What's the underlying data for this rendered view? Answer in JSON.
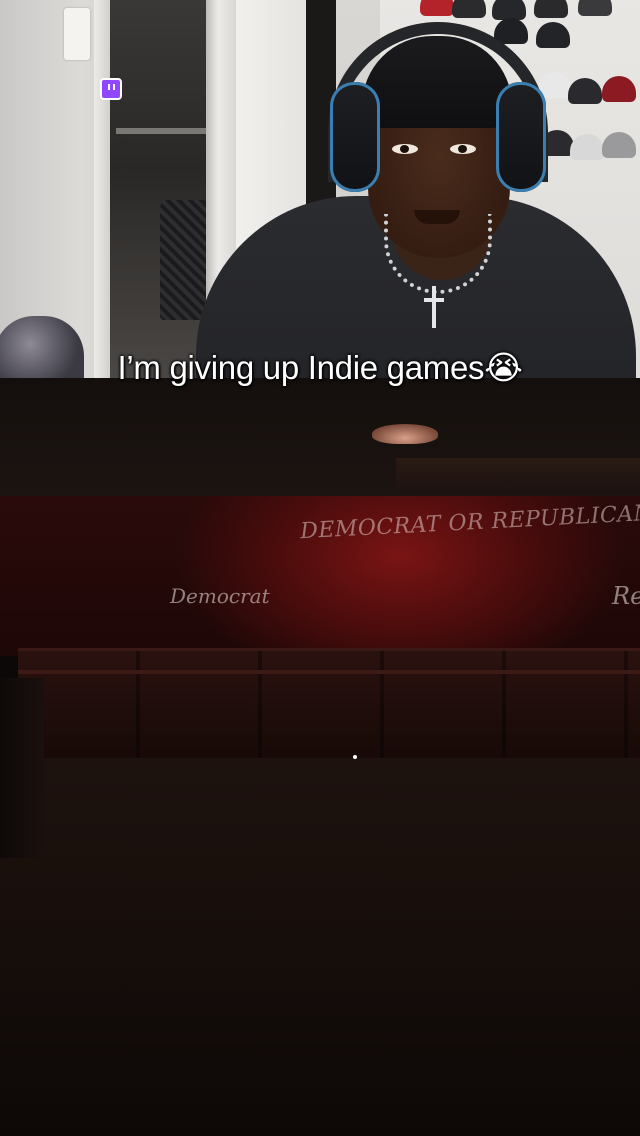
{
  "caption": {
    "text": "I’m giving up Indie games😭"
  },
  "stream_overlay": {
    "platform_icon": "twitch-icon",
    "accent_color": "#9146ff"
  },
  "game_scene": {
    "sign_title": "DEMOCRAT OR REPUBLICAN",
    "option_left": "Democrat",
    "option_right": "Re",
    "wall_color": "#6b1212"
  }
}
